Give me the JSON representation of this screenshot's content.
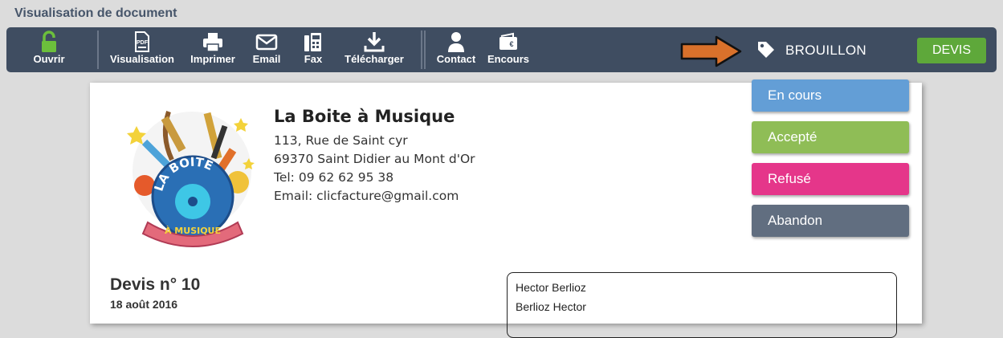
{
  "page": {
    "title": "Visualisation de document"
  },
  "toolbar": {
    "buttons": [
      {
        "label": "Ouvrir",
        "icon": "unlock-icon"
      },
      {
        "label": "Visualisation",
        "icon": "pdf-icon"
      },
      {
        "label": "Imprimer",
        "icon": "printer-icon"
      },
      {
        "label": "Email",
        "icon": "envelope-icon"
      },
      {
        "label": "Fax",
        "icon": "fax-icon"
      },
      {
        "label": "Télécharger",
        "icon": "download-icon"
      },
      {
        "label": "Contact",
        "icon": "user-icon"
      },
      {
        "label": "Encours",
        "icon": "wallet-icon"
      }
    ],
    "status": {
      "label": "BROUILLON",
      "icon": "tag-icon"
    },
    "doc_type_button": "DEVIS"
  },
  "status_menu": {
    "items": [
      {
        "label": "En cours",
        "color": "#639ed6"
      },
      {
        "label": "Accepté",
        "color": "#8fbd56"
      },
      {
        "label": "Refusé",
        "color": "#e5368a"
      },
      {
        "label": "Abandon",
        "color": "#616e80"
      }
    ]
  },
  "document": {
    "company": {
      "name": "La Boite à Musique",
      "address1": "113, Rue de Saint cyr",
      "address2": "69370 Saint Didier au Mont d'Or",
      "phone": "Tel: 09 62 62 95 38",
      "email": "Email: clicfacture@gmail.com",
      "logo_text_top": "LA BOITE",
      "logo_text_bottom": "À MUSIQUE"
    },
    "title": "Devis n° 10",
    "date": "18 août 2016",
    "client": {
      "line1": "Hector Berlioz",
      "line2": "Berlioz Hector"
    }
  },
  "colors": {
    "toolbar_bg": "#3f4d61",
    "unlock_green": "#6cbf3c",
    "devis_green": "#5ea83a",
    "arrow_orange": "#d9712b"
  }
}
